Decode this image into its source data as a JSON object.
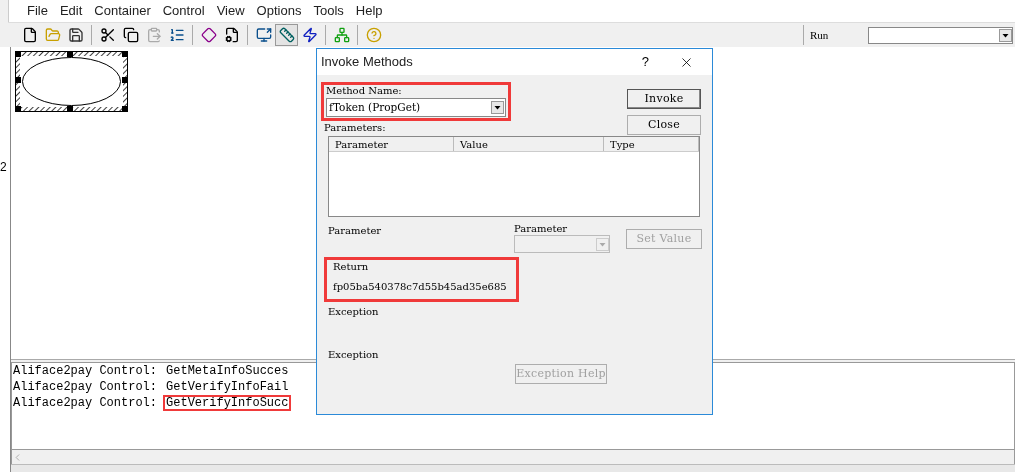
{
  "menu": [
    "File",
    "Edit",
    "Container",
    "Control",
    "View",
    "Options",
    "Tools",
    "Help"
  ],
  "toolbar": [
    {
      "kind": "button",
      "disabled": false,
      "selected": false
    },
    {
      "kind": "button",
      "disabled": false,
      "selected": false
    },
    {
      "kind": "button",
      "disabled": false,
      "selected": false
    },
    {
      "kind": "separator"
    },
    {
      "kind": "button",
      "disabled": false,
      "selected": false
    },
    {
      "kind": "button",
      "disabled": false,
      "selected": false
    },
    {
      "kind": "button",
      "disabled": true,
      "selected": false
    },
    {
      "kind": "button",
      "disabled": false,
      "selected": false
    },
    {
      "kind": "separator"
    },
    {
      "kind": "button",
      "disabled": false,
      "selected": false
    },
    {
      "kind": "button",
      "disabled": false,
      "selected": false
    },
    {
      "kind": "separator"
    },
    {
      "kind": "button",
      "disabled": false,
      "selected": false
    },
    {
      "kind": "button",
      "disabled": false,
      "selected": true
    },
    {
      "kind": "button",
      "disabled": false,
      "selected": false
    },
    {
      "kind": "separator"
    },
    {
      "kind": "button",
      "disabled": false,
      "selected": false
    },
    {
      "kind": "separator"
    },
    {
      "kind": "button",
      "disabled": false,
      "selected": false
    }
  ],
  "run": {
    "label": "Run"
  },
  "left_fragments": [
    "2"
  ],
  "log_lines": [
    {
      "source": "Aliface2pay Control:",
      "message": "GetMetaInfoSucces",
      "highlighted": false
    },
    {
      "source": "Aliface2pay Control:",
      "message": "GetVerifyInfoFail",
      "highlighted": false
    },
    {
      "source": "Aliface2pay Control:",
      "message": "GetVerifyInfoSucc",
      "highlighted": true
    }
  ],
  "dialog": {
    "title": "Invoke Methods",
    "help": "?",
    "method": {
      "label": "Method Name:",
      "value": "fToken (PropGet)",
      "highlighted": true
    },
    "buttons": [
      {
        "label": "Invoke",
        "selected": true
      },
      {
        "label": "Close",
        "selected": false
      }
    ],
    "parameters": {
      "label": "Parameters:",
      "columns": [
        "Parameter",
        "Value",
        "Type"
      ]
    },
    "parameter_label": "Parameter",
    "parameter_combo": {
      "label": "Parameter",
      "disabled": true
    },
    "set_value": {
      "label": "Set Value",
      "disabled": true
    },
    "return": {
      "label": "Return",
      "value": "fp05ba540378c7d55b45ad35e685",
      "highlighted": true
    },
    "exception_labels": [
      "Exception",
      "Exception"
    ],
    "exception_help": {
      "label": "Exception Help",
      "disabled": true
    }
  }
}
